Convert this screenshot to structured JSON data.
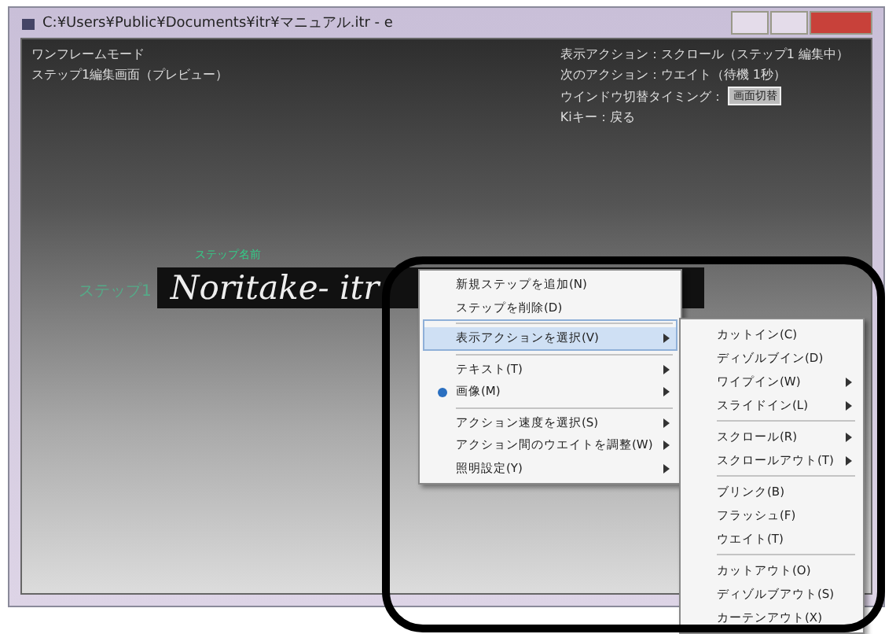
{
  "window": {
    "title": "C:¥Users¥Public¥Documents¥itr¥マニュアル.itr - e"
  },
  "status": {
    "mode": "ワンフレームモード",
    "screen": "ステップ1編集画面（プレビュー）",
    "info": [
      "表示アクション：スクロール（ステップ1 編集中）",
      "次のアクション：ウエイト（待機 1秒）"
    ],
    "switch_label": "ウインドウ切替タイミング：",
    "switch_button": "画面切替",
    "key_hint": "Kiキー：戻る"
  },
  "step": {
    "caption": "ステップ名前",
    "label": "ステップ1",
    "banner": "Noritake- itr"
  },
  "context_menu": [
    {
      "label": "新規ステップを追加(N)",
      "selected": false,
      "checked": false,
      "submenu": false,
      "separator_before": false
    },
    {
      "label": "ステップを削除(D)",
      "selected": false,
      "checked": false,
      "submenu": false,
      "separator_before": false
    },
    {
      "label": "表示アクションを選択(V)",
      "selected": true,
      "checked": false,
      "submenu": true,
      "separator_before": true
    },
    {
      "label": "テキスト(T)",
      "selected": false,
      "checked": false,
      "submenu": true,
      "separator_before": true
    },
    {
      "label": "画像(M)",
      "selected": false,
      "checked": true,
      "submenu": true,
      "separator_before": false
    },
    {
      "label": "アクション速度を選択(S)",
      "selected": false,
      "checked": false,
      "submenu": true,
      "separator_before": true
    },
    {
      "label": "アクション間のウエイトを調整(W)",
      "selected": false,
      "checked": false,
      "submenu": true,
      "separator_before": false
    },
    {
      "label": "照明設定(Y)",
      "selected": false,
      "checked": false,
      "submenu": true,
      "separator_before": false
    }
  ],
  "submenu": [
    {
      "label": "カットイン(C)",
      "submenu": false,
      "separator_before": false
    },
    {
      "label": "ディゾルブイン(D)",
      "submenu": false,
      "separator_before": false
    },
    {
      "label": "ワイプイン(W)",
      "submenu": true,
      "separator_before": false
    },
    {
      "label": "スライドイン(L)",
      "submenu": true,
      "separator_before": false
    },
    {
      "label": "スクロール(R)",
      "submenu": true,
      "separator_before": true
    },
    {
      "label": "スクロールアウト(T)",
      "submenu": true,
      "separator_before": false
    },
    {
      "label": "ブリンク(B)",
      "submenu": false,
      "separator_before": true
    },
    {
      "label": "フラッシュ(F)",
      "submenu": false,
      "separator_before": false
    },
    {
      "label": "ウエイト(T)",
      "submenu": false,
      "separator_before": false
    },
    {
      "label": "カットアウト(O)",
      "submenu": false,
      "separator_before": true
    },
    {
      "label": "ディゾルブアウト(S)",
      "submenu": false,
      "separator_before": false
    },
    {
      "label": "カーテンアウト(X)",
      "submenu": false,
      "separator_before": false
    }
  ]
}
